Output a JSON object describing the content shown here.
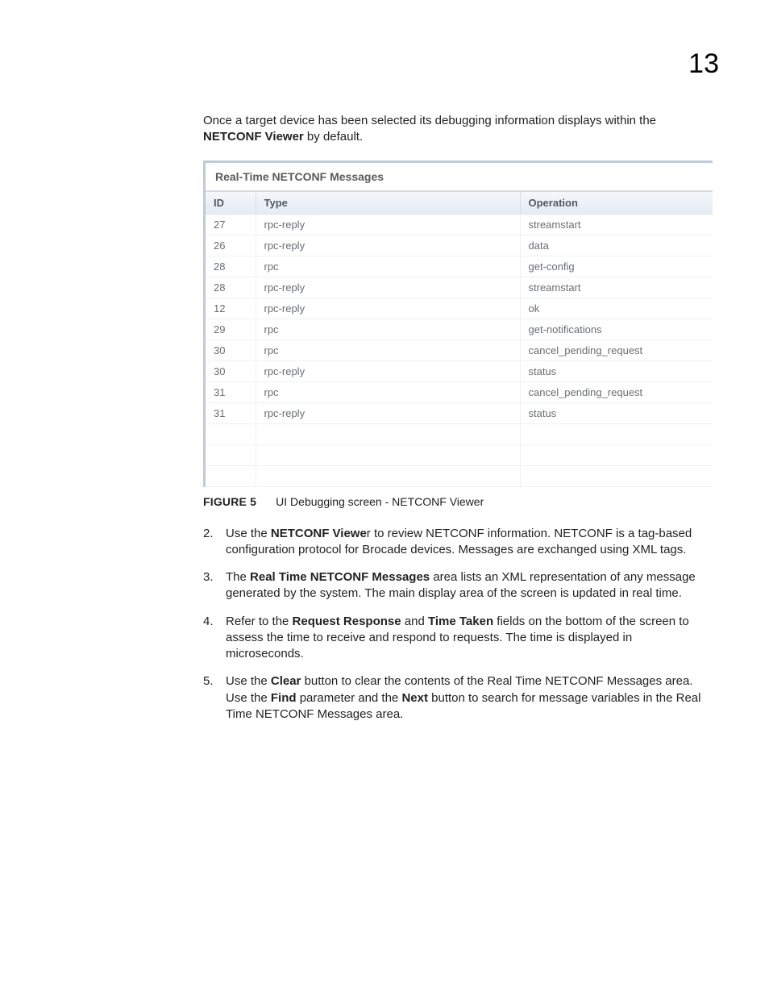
{
  "page_number": "13",
  "intro": {
    "pre": "Once a target device has been selected its debugging information displays within the ",
    "bold1": "NETCONF Viewer",
    "post": " by default."
  },
  "panel": {
    "title": "Real-Time NETCONF Messages",
    "columns": {
      "id": "ID",
      "type": "Type",
      "operation": "Operation"
    },
    "rows": [
      {
        "id": "27",
        "type": "rpc-reply",
        "operation": "streamstart"
      },
      {
        "id": "26",
        "type": "rpc-reply",
        "operation": "data"
      },
      {
        "id": "28",
        "type": "rpc",
        "operation": "get-config"
      },
      {
        "id": "28",
        "type": "rpc-reply",
        "operation": "streamstart"
      },
      {
        "id": "12",
        "type": "rpc-reply",
        "operation": "ok"
      },
      {
        "id": "29",
        "type": "rpc",
        "operation": "get-notifications"
      },
      {
        "id": "30",
        "type": "rpc",
        "operation": "cancel_pending_request"
      },
      {
        "id": "30",
        "type": "rpc-reply",
        "operation": "status"
      },
      {
        "id": "31",
        "type": "rpc",
        "operation": "cancel_pending_request"
      },
      {
        "id": "31",
        "type": "rpc-reply",
        "operation": "status"
      }
    ],
    "empty_rows": 3
  },
  "figure": {
    "label": "FIGURE 5",
    "caption": "UI Debugging screen - NETCONF Viewer"
  },
  "steps": [
    {
      "parts": [
        {
          "t": "Use the "
        },
        {
          "t": "NETCONF Viewe",
          "b": true
        },
        {
          "t": "r to review NETCONF information. NETCONF is a tag-based configuration protocol for Brocade devices. Messages are exchanged using XML tags."
        }
      ]
    },
    {
      "parts": [
        {
          "t": "The "
        },
        {
          "t": "Real Time NETCONF Messages",
          "b": true
        },
        {
          "t": " area lists an XML representation of any message generated by the system. The main display area of the screen is updated in real time."
        }
      ]
    },
    {
      "parts": [
        {
          "t": "Refer to the "
        },
        {
          "t": "Request Response",
          "b": true
        },
        {
          "t": " and "
        },
        {
          "t": "Time Taken",
          "b": true
        },
        {
          "t": " fields on the bottom of the screen to assess the time to receive and respond to requests. The time is displayed in microseconds."
        }
      ]
    },
    {
      "parts": [
        {
          "t": "Use the "
        },
        {
          "t": "Clear",
          "b": true
        },
        {
          "t": " button to clear the contents of the Real Time NETCONF Messages area. Use the "
        },
        {
          "t": "Find",
          "b": true
        },
        {
          "t": " parameter and the "
        },
        {
          "t": "Next",
          "b": true
        },
        {
          "t": " button to search for message variables in the Real Time NETCONF Messages area."
        }
      ]
    }
  ]
}
